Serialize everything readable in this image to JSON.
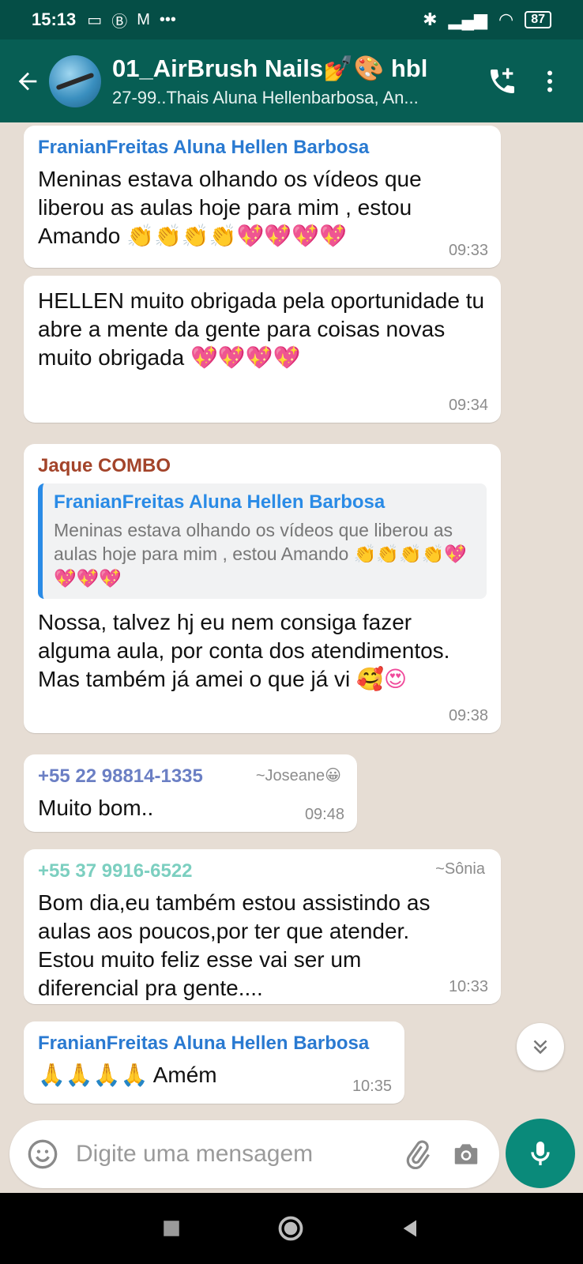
{
  "status_bar": {
    "time": "15:13",
    "battery": "87"
  },
  "header": {
    "title": "01_AirBrush Nails💅🎨 hbl",
    "subtitle": "27-99..Thais Aluna Hellenbarbosa, An..."
  },
  "messages": [
    {
      "sender": "FranianFreitas Aluna Hellen Barbosa",
      "sender_color": "#2a7ad1",
      "text": "Meninas estava olhando os vídeos que liberou as aulas hoje para mim , estou Amando",
      "emojis": "👏👏👏👏💖💖💖💖",
      "time": "09:33"
    },
    {
      "text": "HELLEN muito obrigada pela oportunidade tu abre a mente da gente para coisas novas muito obrigada",
      "emojis": "💖💖💖💖",
      "time": "09:34"
    },
    {
      "sender": "Jaque COMBO",
      "sender_color": "#a3442a",
      "quote": {
        "sender": "FranianFreitas Aluna Hellen Barbosa",
        "text": "Meninas estava olhando os vídeos que liberou as aulas hoje para mim , estou Amando",
        "emojis": "👏👏👏👏💖💖💖💖"
      },
      "text": "Nossa, talvez hj eu nem consiga fazer alguma aula, por conta dos atendimentos. Mas também já amei o que já vi",
      "emojis": "🥰😍",
      "time": "09:38"
    },
    {
      "sender": "+55 22 98814-1335",
      "sender_color": "#6b7fc4",
      "alias": "~Joseane😀",
      "text": "Muito bom..",
      "time": "09:48"
    },
    {
      "sender": "+55 37 9916-6522",
      "sender_color": "#7ccfc0",
      "alias": "~Sônia",
      "text": "Bom dia,eu também estou assistindo as aulas aos poucos,por ter que atender. Estou muito feliz esse vai ser um diferencial pra gente....",
      "time": "10:33"
    },
    {
      "sender": "FranianFreitas Aluna Hellen Barbosa",
      "sender_color": "#2a7ad1",
      "emojis": "🙏🙏🙏🙏",
      "text": "Amém",
      "time": "10:35"
    }
  ],
  "input": {
    "placeholder": "Digite uma mensagem"
  },
  "icons": {
    "back": "arrow-left-icon",
    "add_call": "phone-plus-icon",
    "menu": "kebab-menu-icon",
    "emoji": "smiley-icon",
    "attach": "paperclip-icon",
    "camera": "camera-icon",
    "mic": "microphone-icon",
    "scroll_down": "double-chevron-down-icon"
  },
  "colors": {
    "header": "#075e54",
    "accent": "#0a8a7a",
    "chat_bg": "#e6ddd4"
  }
}
